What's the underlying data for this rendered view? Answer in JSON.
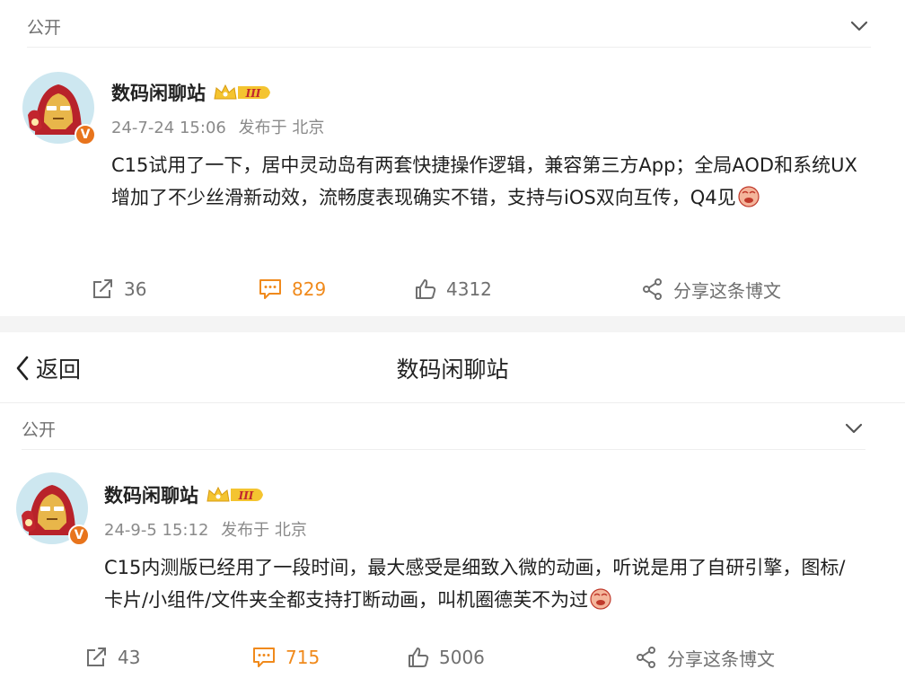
{
  "nav": {
    "back_label": "返回",
    "title": "数码闲聊站"
  },
  "posts": [
    {
      "visibility": "公开",
      "author": "数码闲聊站",
      "member_level": "III",
      "timestamp": "24-7-24 15:06",
      "location": "发布于 北京",
      "text": "C15试用了一下，居中灵动岛有两套快捷操作逻辑，兼容第三方App；全局AOD和系统UX增加了不少丝滑新动效，流畅度表现确实不错，支持与iOS双向互传，Q4见",
      "reposts": "36",
      "comments": "829",
      "likes": "4312",
      "share_label": "分享这条博文"
    },
    {
      "visibility": "公开",
      "author": "数码闲聊站",
      "member_level": "III",
      "timestamp": "24-9-5 15:12",
      "location": "发布于 北京",
      "text": "C15内测版已经用了一段时间，最大感受是细致入微的动画，听说是用了自研引擎，图标/卡片/小组件/文件夹全都支持打断动画，叫机圈德芙不为过",
      "reposts": "43",
      "comments": "715",
      "likes": "5006",
      "share_label": "分享这条博文"
    }
  ],
  "icons": {
    "chevron": "chevron-down-icon",
    "repost": "repost-icon",
    "comment": "comment-icon",
    "like": "thumbs-up-icon",
    "share": "share-icon",
    "verified": "verified-v-icon",
    "crown": "crown-icon",
    "emoji": "emoji-face-icon",
    "back": "chevron-left-icon"
  },
  "colors": {
    "comment_accent": "#f08a1c",
    "verified": "#e8741c",
    "badge_gold": "#f4c430",
    "muted": "#8a8a8a"
  }
}
